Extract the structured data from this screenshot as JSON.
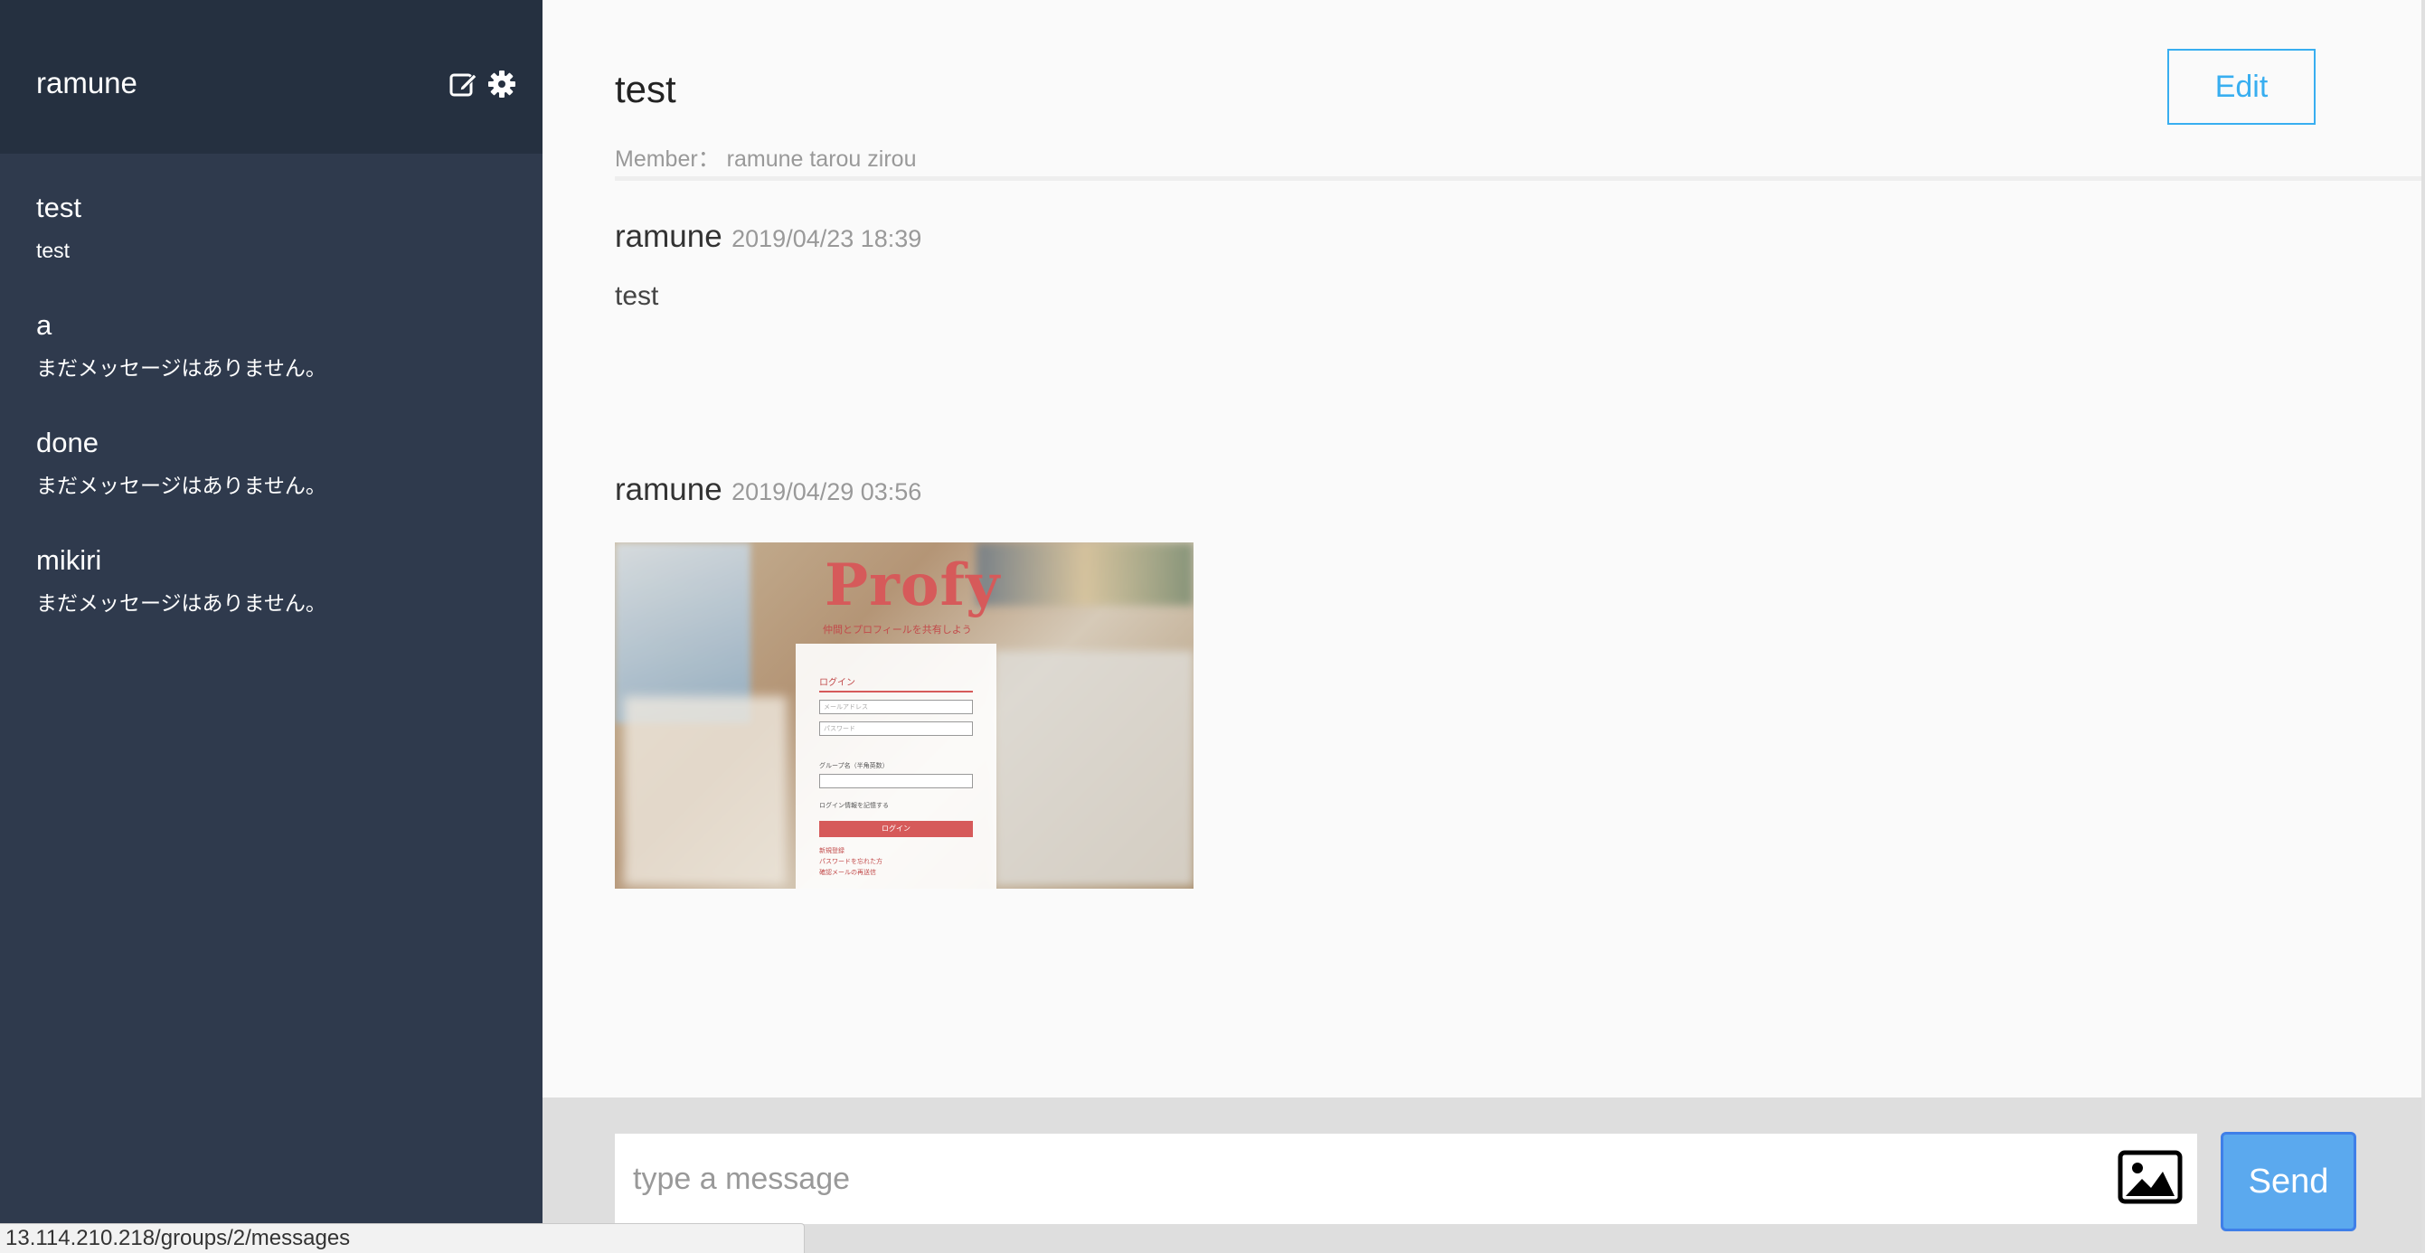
{
  "sidebar": {
    "user_name": "ramune",
    "edit_icon": "edit-icon",
    "settings_icon": "gear-icon",
    "groups": [
      {
        "name": "test",
        "last_message": "test"
      },
      {
        "name": "a",
        "last_message": "まだメッセージはありません。"
      },
      {
        "name": "done",
        "last_message": "まだメッセージはありません。"
      },
      {
        "name": "mikiri",
        "last_message": "まだメッセージはありません。"
      }
    ]
  },
  "main": {
    "group_title": "test",
    "member_label": "Member：",
    "members": "ramune tarou zirou",
    "edit_label": "Edit",
    "messages": [
      {
        "user": "ramune",
        "date": "2019/04/23 18:39",
        "text": "test"
      },
      {
        "user": "ramune",
        "date": "2019/04/29 03:56",
        "image": {
          "logo_text": "Profy",
          "tagline": "仲間とプロフィールを共有しよう",
          "login_title": "ログイン",
          "email_placeholder": "メールアドレス",
          "password_placeholder": "パスワード",
          "group_label": "グループ名（半角英数）",
          "remember_label": "ログイン情報を記憶する",
          "login_button": "ログイン",
          "links": [
            "新規登録",
            "パスワードを忘れた方",
            "確認メールの再送信"
          ]
        }
      }
    ]
  },
  "form": {
    "placeholder": "type a message",
    "image_icon": "image-icon",
    "send_label": "Send"
  },
  "status_bar": {
    "url": "13.114.210.218/groups/2/messages"
  },
  "colors": {
    "sidebar_bg": "#2f3a4d",
    "sidebar_header_bg": "#253040",
    "accent_blue": "#38aef0",
    "send_bg": "#5ba9ee",
    "form_bg": "#dedede"
  }
}
